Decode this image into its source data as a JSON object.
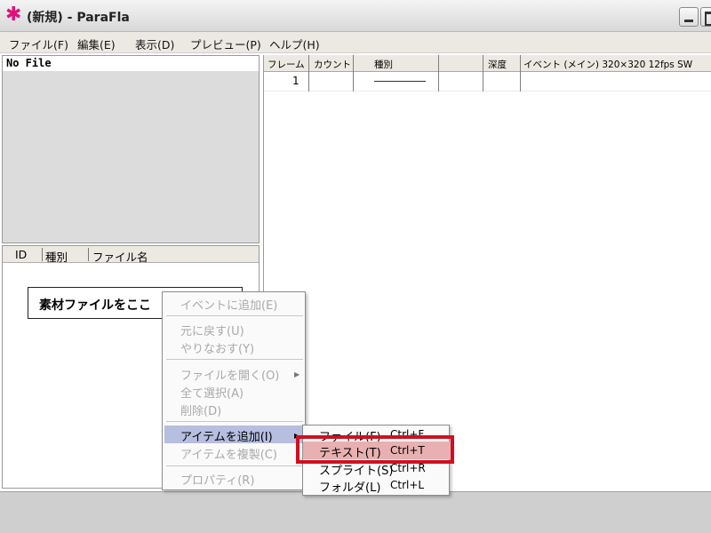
{
  "window": {
    "app_icon_glyph": "✱",
    "title": "(新規) - ParaFla"
  },
  "menubar": {
    "items": [
      "ファイル(F)",
      "編集(E)",
      "表示(D)",
      "プレビュー(P)",
      "ヘルプ(H)"
    ]
  },
  "left_top": {
    "file_label": "No File"
  },
  "asset_list": {
    "columns": [
      "ID",
      "種別",
      "ファイル名"
    ],
    "drop_hint": "素材ファイルをここ"
  },
  "timeline": {
    "columns": [
      "フレーム",
      "カウント",
      "種別",
      "",
      "深度",
      "イベント (メイン) 320×320 12fps SW"
    ],
    "rows": [
      {
        "frame": "1"
      }
    ]
  },
  "context_menu": {
    "items": [
      {
        "label": "イベントに追加(E)",
        "enabled": false
      },
      {
        "label": "元に戻す(U)",
        "enabled": false
      },
      {
        "label": "やりなおす(Y)",
        "enabled": false
      },
      {
        "label": "ファイルを開く(O)",
        "enabled": false
      },
      {
        "label": "全て選択(A)",
        "enabled": false
      },
      {
        "label": "削除(D)",
        "enabled": false
      },
      {
        "label": "アイテムを追加(I)",
        "enabled": true
      },
      {
        "label": "アイテムを複製(C)",
        "enabled": false
      },
      {
        "label": "プロパティ(R)",
        "enabled": false
      }
    ]
  },
  "submenu": {
    "items": [
      {
        "label": "ファイル(F)",
        "shortcut": "Ctrl+F"
      },
      {
        "label": "テキスト(T)",
        "shortcut": "Ctrl+T"
      },
      {
        "label": "スプライト(S)",
        "shortcut": "Ctrl+R"
      },
      {
        "label": "フォルダ(L)",
        "shortcut": "Ctrl+L"
      }
    ]
  },
  "colors": {
    "highlight_box": "#cf1020",
    "menu_selection": "#b6bfe0"
  }
}
